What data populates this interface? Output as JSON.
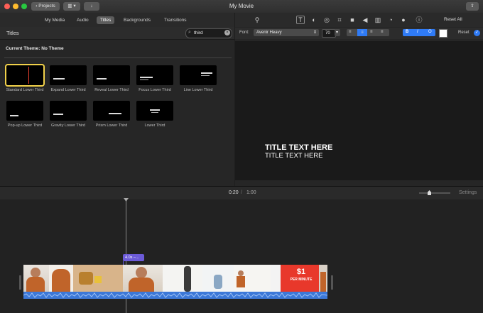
{
  "window": {
    "title": "My Movie",
    "projects_label": "Projects"
  },
  "tabs": [
    {
      "label": "My Media"
    },
    {
      "label": "Audio"
    },
    {
      "label": "Titles"
    },
    {
      "label": "Backgrounds"
    },
    {
      "label": "Transitions"
    }
  ],
  "browser": {
    "section_title": "Titles",
    "search_value": "third",
    "theme_label": "Current Theme: No Theme",
    "items": [
      {
        "label": "Standard Lower Third",
        "preview": ""
      },
      {
        "label": "Expand Lower Third",
        "preview": ""
      },
      {
        "label": "Reveal Lower Third",
        "preview": ""
      },
      {
        "label": "Focus Lower Third",
        "preview": ""
      },
      {
        "label": "Line Lower Third",
        "preview": ""
      },
      {
        "label": "Pop-up Lower Third",
        "preview": ""
      },
      {
        "label": "Gravity Lower Third",
        "preview": ""
      },
      {
        "label": "Prism Lower Third",
        "preview": ""
      },
      {
        "label": "Lower Third",
        "preview": ""
      }
    ]
  },
  "viewer": {
    "reset_all": "Reset All",
    "font_label": "Font:",
    "font_name": "Avenir Heavy",
    "font_size": "70",
    "style_buttons": [
      "B",
      "I",
      "O"
    ],
    "reset_label": "Reset",
    "preview_line1": "TITLE TEXT HERE",
    "preview_line2": "TITLE TEXT HERE"
  },
  "timeline": {
    "current_time": "0:20",
    "total_time": "1:00",
    "settings_label": "Settings",
    "title_clip_label": "4.0s –...",
    "ad_text_line1": "$1",
    "ad_text_line2": "PER MINUTE"
  },
  "colors": {
    "selection": "#f1d14a",
    "accent": "#2f7bf6",
    "title_clip": "#6c5bd8",
    "audio_wave": "#3c78d8"
  }
}
